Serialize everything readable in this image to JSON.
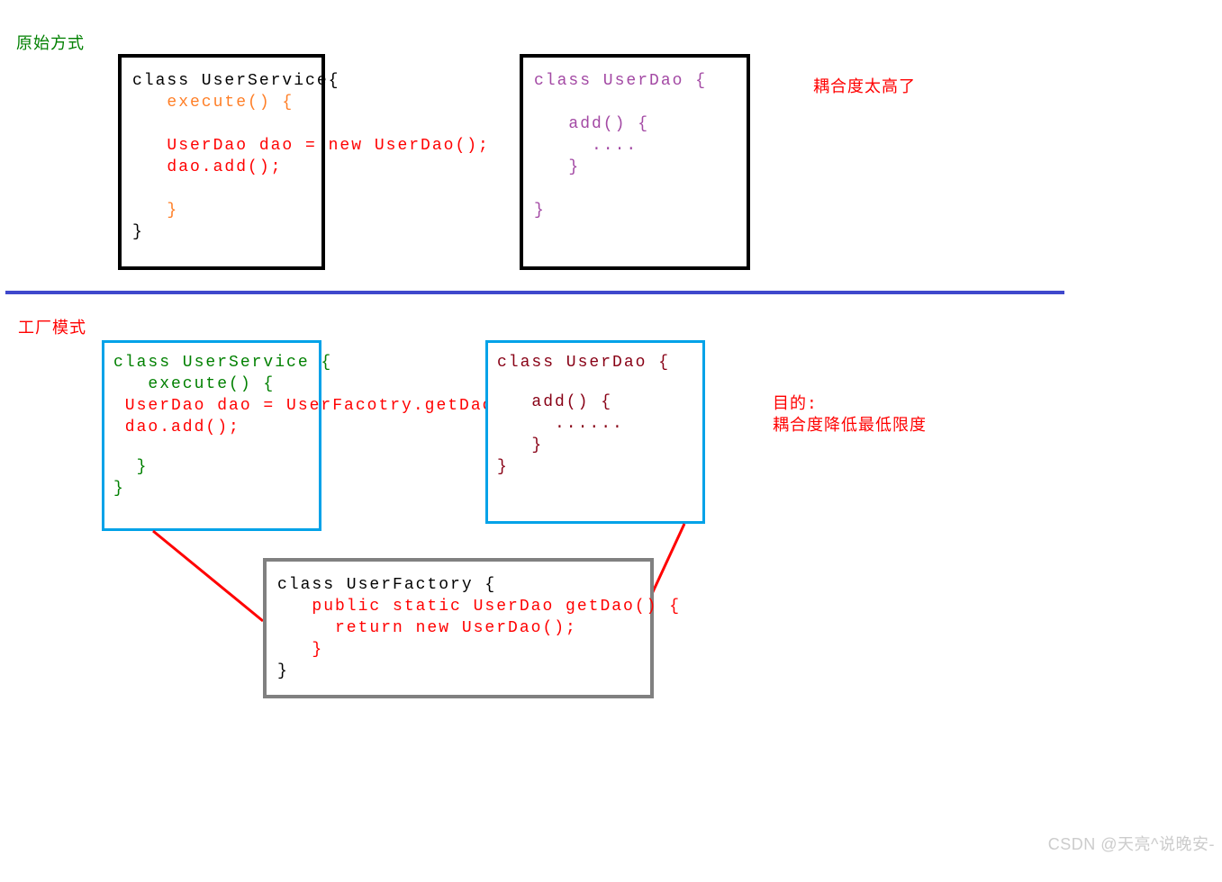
{
  "section1": {
    "heading": "原始方式",
    "box1": {
      "l1": "class UserService{",
      "l2": "   execute() {",
      "l3": "   UserDao dao = new UserDao();",
      "l4": "   dao.add();",
      "l5": "   }",
      "l6": "}"
    },
    "box2": {
      "l1": "class UserDao {",
      "l2": "   add() {",
      "l3": "     ....",
      "l4": "   }",
      "l5": "}"
    },
    "comment": "耦合度太高了"
  },
  "section2": {
    "heading": "工厂模式",
    "box1": {
      "l1": "class UserService {",
      "l2": "   execute() {",
      "l3": " UserDao dao = UserFacotry.getDao();",
      "l4": " dao.add();",
      "l5": "  }",
      "l6": "}"
    },
    "box2": {
      "l1": "class UserDao {",
      "l2": "   add() {",
      "l3": "     ......",
      "l4": "   }",
      "l5": "}"
    },
    "box3": {
      "l1": "class UserFactory {",
      "l2": "   public static UserDao getDao() {",
      "l3": "     return new UserDao();",
      "l4": "   }",
      "l5": "}"
    },
    "comment1": "目的:",
    "comment2": "耦合度降低最低限度"
  },
  "watermark": "CSDN @天亮^说晚安-"
}
